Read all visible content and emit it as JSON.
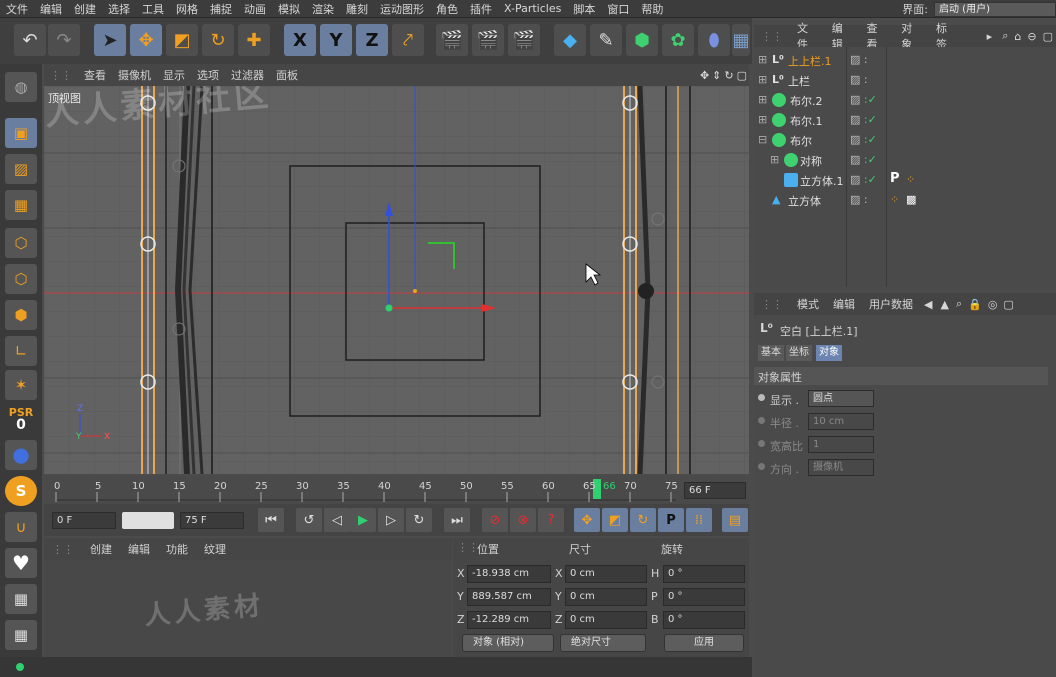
{
  "menubar": {
    "items": [
      "文件",
      "编辑",
      "创建",
      "选择",
      "工具",
      "网格",
      "捕捉",
      "动画",
      "模拟",
      "渲染",
      "雕刻",
      "运动图形",
      "角色",
      "插件",
      "X-Particles",
      "脚本",
      "窗口",
      "帮助"
    ],
    "layout_label": "界面:",
    "layout_value": "启动 (用户)"
  },
  "toolbar": {
    "icons": [
      "undo-icon",
      "redo-icon",
      "select-icon",
      "move-icon",
      "scale-icon",
      "rotate-icon",
      "add-icon",
      "x-axis-icon",
      "y-axis-icon",
      "z-axis-icon",
      "coordinate-icon",
      "render-view-icon",
      "render-picture-icon",
      "render-settings-icon",
      "cube-icon",
      "spline-pen-icon",
      "subdivision-icon",
      "cloner-icon",
      "deformer-icon",
      "floor-icon"
    ],
    "axis_x": "X",
    "axis_y": "Y",
    "axis_z": "Z"
  },
  "viewport": {
    "menu": [
      "查看",
      "摄像机",
      "显示",
      "选项",
      "过滤器",
      "面板"
    ],
    "label": "顶视图",
    "axis_x": "X",
    "axis_y": "Y",
    "axis_z": "Z"
  },
  "timeline": {
    "ticks": [
      "0",
      "5",
      "10",
      "15",
      "20",
      "25",
      "30",
      "35",
      "40",
      "45",
      "50",
      "55",
      "60",
      "65",
      "66",
      "70",
      "75"
    ],
    "current_frame": "66 F"
  },
  "transport": {
    "start": "0 F",
    "end": "75 F"
  },
  "material": {
    "menu": [
      "创建",
      "编辑",
      "功能",
      "纹理"
    ]
  },
  "coordinates": {
    "headers": [
      "位置",
      "尺寸",
      "旋转"
    ],
    "rows": [
      {
        "axis": "X",
        "pos": "-18.938 cm",
        "size_axis": "X",
        "size": "0 cm",
        "rot_axis": "H",
        "rot": "0 °"
      },
      {
        "axis": "Y",
        "pos": "889.587 cm",
        "size_axis": "Y",
        "size": "0 cm",
        "rot_axis": "P",
        "rot": "0 °"
      },
      {
        "axis": "Z",
        "pos": "-12.289 cm",
        "size_axis": "Z",
        "size": "0 cm",
        "rot_axis": "B",
        "rot": "0 °"
      }
    ],
    "mode": "对象 (相对)",
    "size_mode": "绝对尺寸",
    "apply": "应用"
  },
  "object_manager": {
    "menu": [
      "文件",
      "编辑",
      "查看",
      "对象",
      "标签"
    ],
    "objects": [
      {
        "name": "上上栏.1",
        "selected": true
      },
      {
        "name": "上栏",
        "selected": false
      },
      {
        "name": "布尔.2",
        "selected": false
      },
      {
        "name": "布尔.1",
        "selected": false
      },
      {
        "name": "布尔",
        "selected": false
      },
      {
        "name": "对称",
        "selected": false
      },
      {
        "name": "立方体.1",
        "selected": false
      },
      {
        "name": "立方体",
        "selected": false
      }
    ],
    "tag_p": "P"
  },
  "attributes": {
    "menu": [
      "模式",
      "编辑",
      "用户数据"
    ],
    "object_title": "空白 [上上栏.1]",
    "tabs": [
      "基本",
      "坐标",
      "对象"
    ],
    "section": "对象属性",
    "props": [
      {
        "label": "显示 .",
        "value": "圆点"
      },
      {
        "label": "半径 .",
        "value": "10 cm"
      },
      {
        "label": "宽高比",
        "value": "1"
      },
      {
        "label": "方向 .",
        "value": "摄像机"
      }
    ]
  },
  "watermark": {
    "text1": "人人素材社区",
    "text2": "人人素材"
  },
  "colors": {
    "accent": "#f0a020",
    "selected_tab": "#6c84b0",
    "x_axis": "#e03030",
    "y_axis": "#2f8f2f",
    "z_axis": "#3050e0"
  }
}
